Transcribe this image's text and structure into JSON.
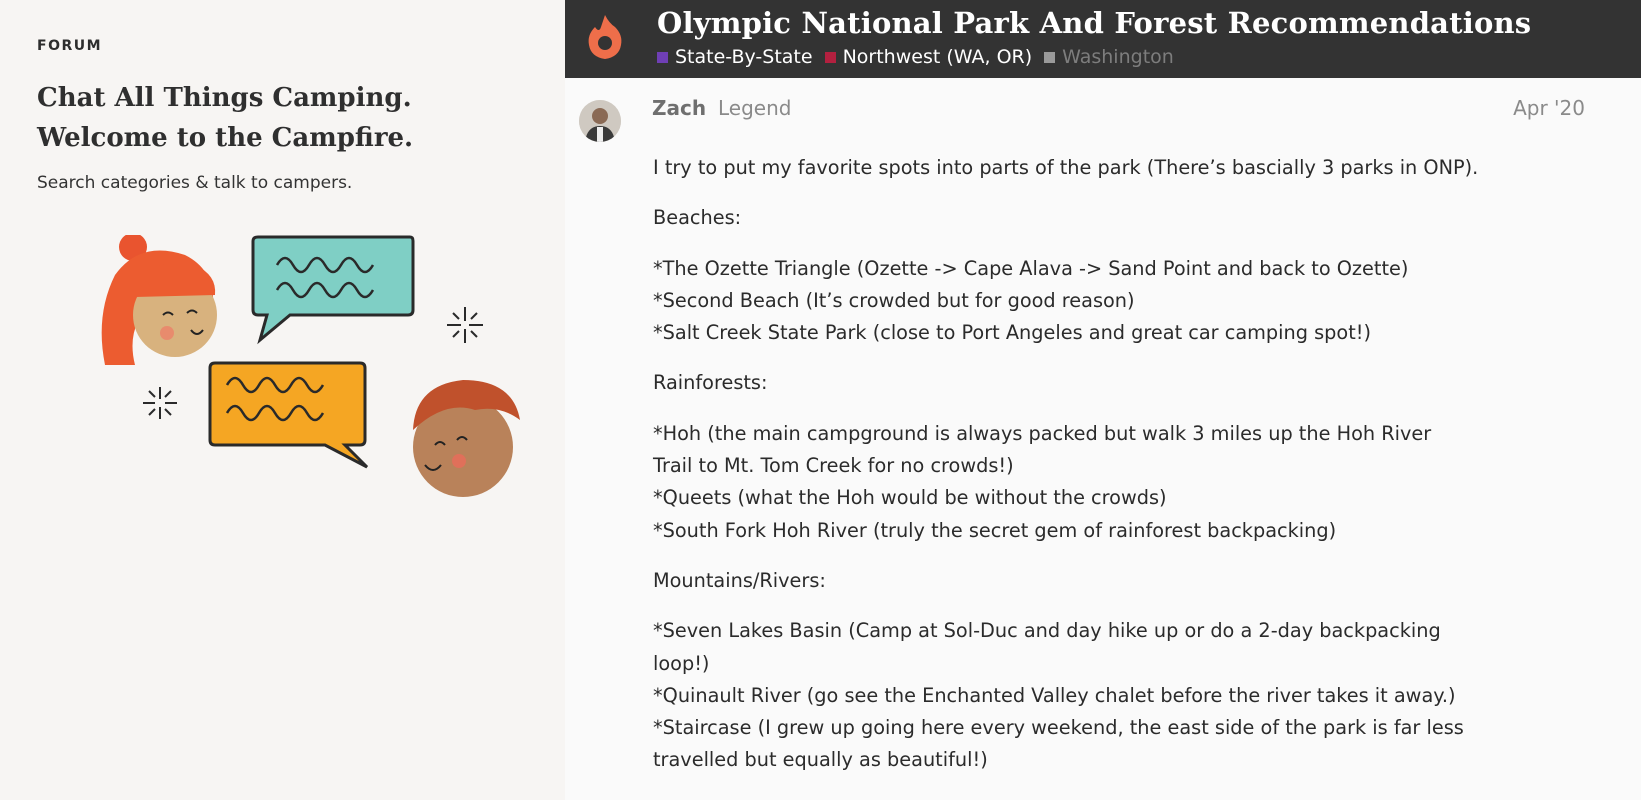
{
  "forum": {
    "eyebrow": "FORUM",
    "headline_line1": "Chat All Things Camping.",
    "headline_line2": "Welcome to the Campfire.",
    "subtitle": "Search categories & talk to campers."
  },
  "topic": {
    "title": "Olympic National Park And Forest Recommendations",
    "breadcrumbs": [
      {
        "label": "State-By-State",
        "color": "#6f3fb5"
      },
      {
        "label": "Northwest (WA, OR)",
        "color": "#b3203f"
      },
      {
        "label": "Washington",
        "color": "#9a9a9a"
      }
    ]
  },
  "post": {
    "author": "Zach",
    "author_title": "Legend",
    "date": "Apr '20",
    "intro": "I try to put my favorite spots into parts of the park (There’s bascially 3 parks in ONP).",
    "sections": [
      {
        "heading": "Beaches:",
        "items": [
          "*The Ozette Triangle (Ozette -> Cape Alava -> Sand Point and back to Ozette)",
          "*Second Beach (It’s crowded but for good reason)",
          "*Salt Creek State Park (close to Port Angeles and great car camping spot!)"
        ]
      },
      {
        "heading": "Rainforests:",
        "items": [
          "*Hoh (the main campground is always packed but walk 3 miles up the Hoh River",
          "Trail to Mt. Tom Creek for no crowds!)",
          "*Queets (what the Hoh would be without the crowds)",
          "*South Fork Hoh River (truly the secret gem of rainforest backpacking)"
        ]
      },
      {
        "heading": "Mountains/Rivers:",
        "items": [
          "*Seven Lakes Basin (Camp at Sol-Duc and day hike up or do a 2-day backpacking",
          "loop!)",
          "*Quinault River (go see the Enchanted Valley chalet before the river takes it away.)",
          "*Staircase (I grew up going here every weekend, the east side of the park is far less",
          "travelled but equally as beautiful!)"
        ]
      }
    ]
  },
  "colors": {
    "topbar": "#333333",
    "logo": "#ee6e4a",
    "left_bg": "#f7f5f3"
  },
  "icons": {
    "logo": "flame-logo-icon",
    "illustration": "campers-chatting-illustration"
  }
}
